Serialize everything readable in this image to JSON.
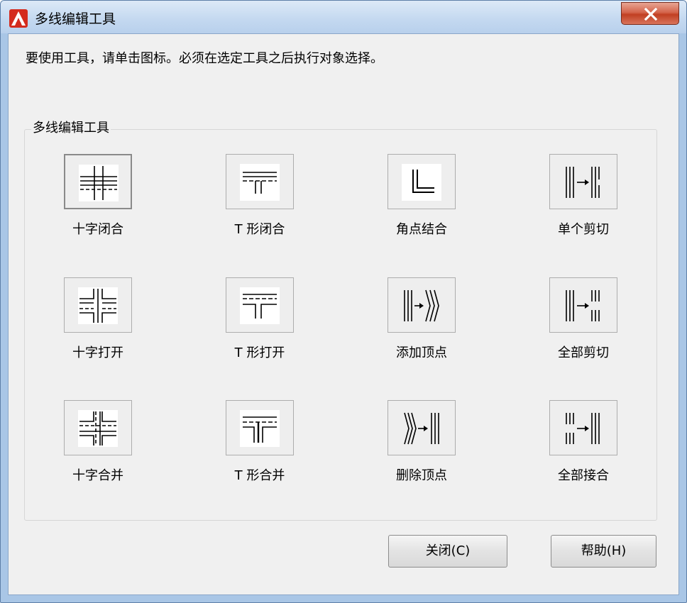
{
  "window": {
    "title": "多线编辑工具"
  },
  "instruction": "要使用工具，请单击图标。必须在选定工具之后执行对象选择。",
  "group": {
    "label": "多线编辑工具"
  },
  "tools": [
    {
      "label": "十字闭合",
      "icon": "closed-cross-icon"
    },
    {
      "label": "T 形闭合",
      "icon": "closed-tee-icon"
    },
    {
      "label": "角点结合",
      "icon": "corner-joint-icon"
    },
    {
      "label": "单个剪切",
      "icon": "cut-single-icon"
    },
    {
      "label": "十字打开",
      "icon": "open-cross-icon"
    },
    {
      "label": "T 形打开",
      "icon": "open-tee-icon"
    },
    {
      "label": "添加顶点",
      "icon": "add-vertex-icon"
    },
    {
      "label": "全部剪切",
      "icon": "cut-all-icon"
    },
    {
      "label": "十字合并",
      "icon": "merged-cross-icon"
    },
    {
      "label": "T 形合并",
      "icon": "merged-tee-icon"
    },
    {
      "label": "删除顶点",
      "icon": "delete-vertex-icon"
    },
    {
      "label": "全部接合",
      "icon": "weld-all-icon"
    }
  ],
  "buttons": {
    "close": "关闭(C)",
    "help": "帮助(H)"
  },
  "colors": {
    "title_close_red": "#c94a30",
    "app_icon_red": "#d42b1e"
  }
}
